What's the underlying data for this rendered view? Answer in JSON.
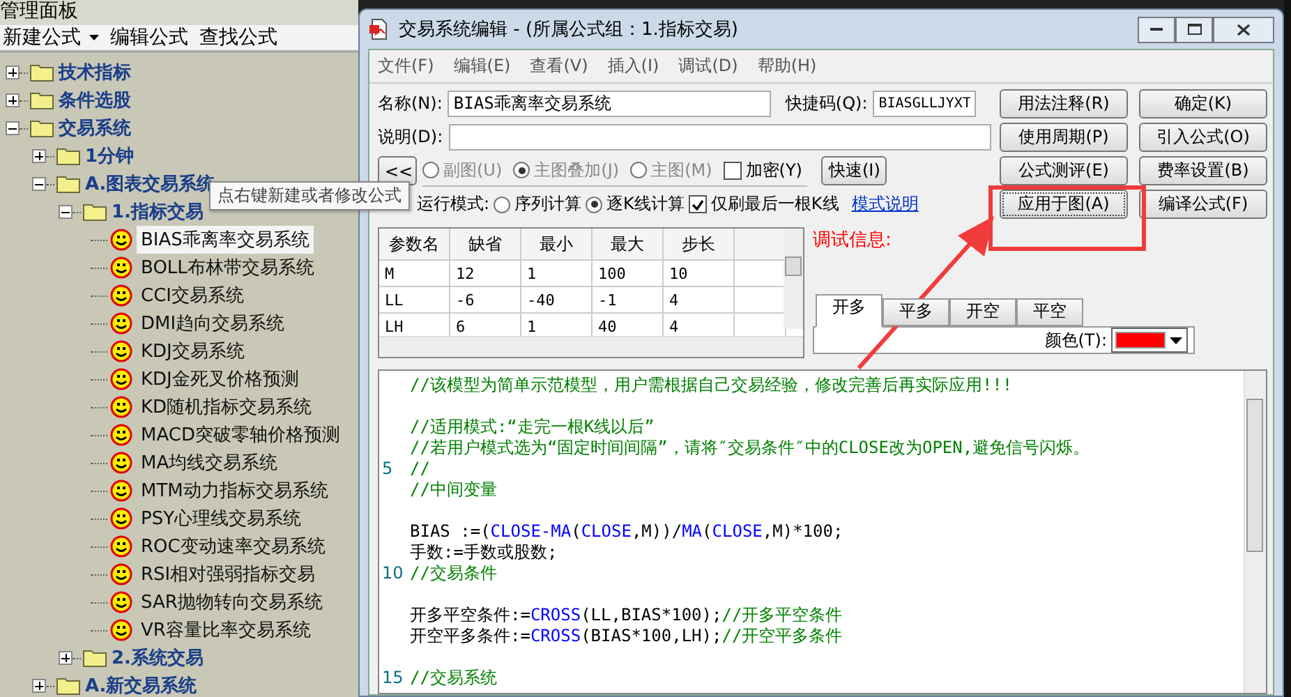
{
  "panel": {
    "title": "管理面板",
    "toolbar": [
      {
        "label": "新建公式",
        "dropdown": true
      },
      {
        "label": "编辑公式",
        "dropdown": false
      },
      {
        "label": "查找公式",
        "dropdown": false
      }
    ],
    "tree": [
      {
        "label": "技术指标",
        "kind": "folder",
        "expanded": false
      },
      {
        "label": "条件选股",
        "kind": "folder",
        "expanded": false
      },
      {
        "label": "交易系统",
        "kind": "folder",
        "expanded": true,
        "children": [
          {
            "label": "1分钟",
            "kind": "folder",
            "expanded": false
          },
          {
            "label": "A.图表交易系统",
            "kind": "folder",
            "expanded": true,
            "children": [
              {
                "label": "1.指标交易",
                "kind": "folder",
                "expanded": true,
                "children": [
                  {
                    "label": "BIAS乖离率交易系统",
                    "kind": "system",
                    "selected": true
                  },
                  {
                    "label": "BOLL布林带交易系统",
                    "kind": "system",
                    "selected": false
                  },
                  {
                    "label": "CCI交易系统",
                    "kind": "system",
                    "selected": false
                  },
                  {
                    "label": "DMI趋向交易系统",
                    "kind": "system",
                    "selected": false
                  },
                  {
                    "label": "KDJ交易系统",
                    "kind": "system",
                    "selected": false
                  },
                  {
                    "label": "KDJ金死叉价格预测",
                    "kind": "system",
                    "selected": false
                  },
                  {
                    "label": "KD随机指标交易系统",
                    "kind": "system",
                    "selected": false
                  },
                  {
                    "label": "MACD突破零轴价格预测",
                    "kind": "system",
                    "selected": false
                  },
                  {
                    "label": "MA均线交易系统",
                    "kind": "system",
                    "selected": false
                  },
                  {
                    "label": "MTM动力指标交易系统",
                    "kind": "system",
                    "selected": false
                  },
                  {
                    "label": "PSY心理线交易系统",
                    "kind": "system",
                    "selected": false
                  },
                  {
                    "label": "ROC变动速率交易系统",
                    "kind": "system",
                    "selected": false
                  },
                  {
                    "label": "RSI相对强弱指标交易",
                    "kind": "system",
                    "selected": false
                  },
                  {
                    "label": "SAR抛物转向交易系统",
                    "kind": "system",
                    "selected": false
                  },
                  {
                    "label": "VR容量比率交易系统",
                    "kind": "system",
                    "selected": false
                  }
                ]
              },
              {
                "label": "2.系统交易",
                "kind": "folder",
                "expanded": false
              }
            ]
          },
          {
            "label": "A.新交易系统",
            "kind": "folder",
            "expanded": false
          }
        ]
      }
    ],
    "tooltip": "点右键新建或者修改公式"
  },
  "dialog": {
    "title": "交易系统编辑 - (所属公式组：1.指标交易)",
    "menu": [
      "文件(F)",
      "编辑(E)",
      "查看(V)",
      "插入(I)",
      "调试(D)",
      "帮助(H)"
    ],
    "name_label": "名称(N):",
    "name_value": "BIAS乖离率交易系统",
    "shortcut_label": "快捷码(Q):",
    "shortcut_value": "BIASGLLJYXT",
    "desc_label": "说明(D):",
    "collapse_button": "<<",
    "chart_types": [
      {
        "label": "副图(U)",
        "selected": false
      },
      {
        "label": "主图叠加(J)",
        "selected": true
      },
      {
        "label": "主图(M)",
        "selected": false
      }
    ],
    "chart_types_disabled": true,
    "encrypt": {
      "label": "加密(Y)",
      "checked": false
    },
    "fast_button": "快速(I)",
    "run_mode_label": "运行模式:",
    "run_modes": [
      {
        "label": "序列计算",
        "selected": false
      },
      {
        "label": "逐K线计算",
        "selected": true
      }
    ],
    "refresh_last": {
      "label": "仅刷最后一根K线",
      "checked": true
    },
    "mode_link": "模式说明",
    "buttons": [
      {
        "label": "用法注释(R)",
        "highlighted": false
      },
      {
        "label": "确定(K)",
        "highlighted": false
      },
      {
        "label": "使用周期(P)",
        "highlighted": false
      },
      {
        "label": "引入公式(O)",
        "highlighted": false
      },
      {
        "label": "公式测评(E)",
        "highlighted": false
      },
      {
        "label": "费率设置(B)",
        "highlighted": false
      },
      {
        "label": "应用于图(A)",
        "highlighted": true
      },
      {
        "label": "编译公式(F)",
        "highlighted": false
      }
    ],
    "params": {
      "columns": [
        "参数名",
        "缺省",
        "最小",
        "最大",
        "步长"
      ],
      "rows": [
        [
          "M",
          "12",
          "1",
          "100",
          "10"
        ],
        [
          "LL",
          "-6",
          "-40",
          "-1",
          "4"
        ],
        [
          "LH",
          "6",
          "1",
          "40",
          "4"
        ]
      ]
    },
    "debug_label": "调试信息:",
    "signal_tabs": [
      {
        "label": "开多",
        "selected": true
      },
      {
        "label": "平多",
        "selected": false
      },
      {
        "label": "开空",
        "selected": false
      },
      {
        "label": "平空",
        "selected": false
      }
    ],
    "color_label": "颜色(T):",
    "color": "#ff0000",
    "code": [
      {
        "blank_before": false,
        "segments": [
          {
            "kind": "comment",
            "text": "//该模型为简单示范模型，用户需根据自己交易经验，修改完善后再实际应用!!!"
          }
        ]
      },
      {
        "blank_before": true,
        "segments": [
          {
            "kind": "comment",
            "text": "//适用模式:“走完一根K线以后”"
          }
        ]
      },
      {
        "blank_before": false,
        "segments": [
          {
            "kind": "comment",
            "text": "//若用户模式选为“固定时间间隔”，请将″交易条件″中的CLOSE改为OPEN,避免信号闪烁。"
          }
        ]
      },
      {
        "blank_before": false,
        "number": "5",
        "segments": [
          {
            "kind": "comment",
            "text": "//"
          }
        ]
      },
      {
        "blank_before": false,
        "segments": [
          {
            "kind": "comment",
            "text": "//中间变量"
          }
        ]
      },
      {
        "blank_before": true,
        "segments": [
          {
            "kind": "plain",
            "text": "BIAS :=("
          },
          {
            "kind": "func",
            "text": "CLOSE-MA"
          },
          {
            "kind": "plain",
            "text": "("
          },
          {
            "kind": "func",
            "text": "CLOSE"
          },
          {
            "kind": "plain",
            "text": ",M))/"
          },
          {
            "kind": "func",
            "text": "MA"
          },
          {
            "kind": "plain",
            "text": "("
          },
          {
            "kind": "func",
            "text": "CLOSE"
          },
          {
            "kind": "plain",
            "text": ",M)*100;"
          }
        ]
      },
      {
        "blank_before": false,
        "segments": [
          {
            "kind": "plain",
            "text": "手数:=手数或股数;"
          }
        ]
      },
      {
        "blank_before": false,
        "number": "10",
        "segments": [
          {
            "kind": "comment",
            "text": "//交易条件"
          }
        ]
      },
      {
        "blank_before": true,
        "segments": [
          {
            "kind": "plain",
            "text": "开多平空条件:="
          },
          {
            "kind": "func",
            "text": "CROSS"
          },
          {
            "kind": "plain",
            "text": "(LL,BIAS*100);"
          },
          {
            "kind": "comment",
            "text": "//开多平空条件"
          }
        ]
      },
      {
        "blank_before": false,
        "segments": [
          {
            "kind": "plain",
            "text": "开空平多条件:="
          },
          {
            "kind": "func",
            "text": "CROSS"
          },
          {
            "kind": "plain",
            "text": "(BIAS*100,LH);"
          },
          {
            "kind": "comment",
            "text": "//开空平多条件"
          }
        ]
      },
      {
        "blank_before": true,
        "number": "15",
        "segments": [
          {
            "kind": "comment",
            "text": "//交易系统"
          }
        ]
      }
    ]
  }
}
